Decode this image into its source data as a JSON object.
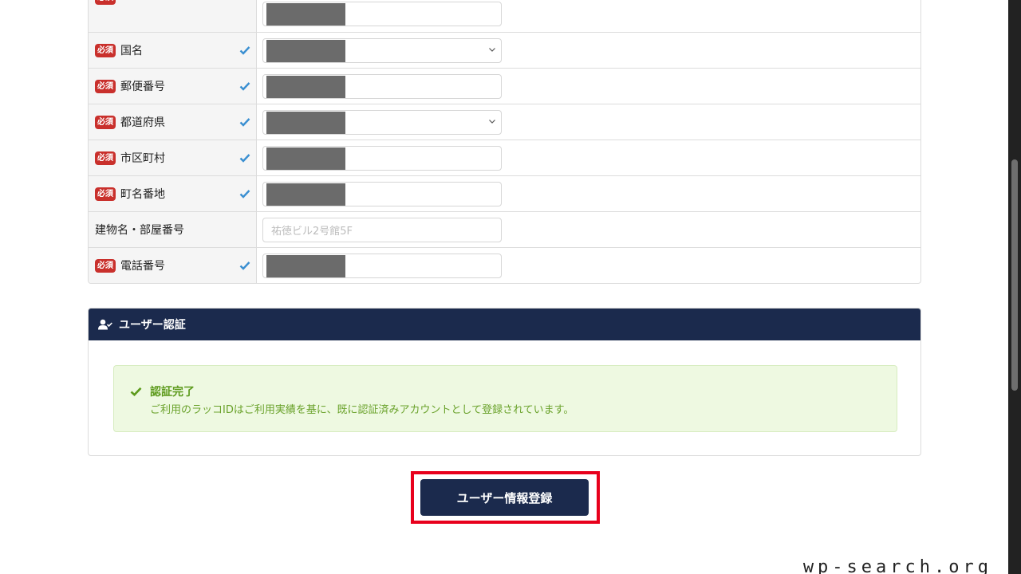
{
  "form": {
    "required_label": "必須",
    "rows": [
      {
        "label": "",
        "required": true,
        "checked": true,
        "type": "text",
        "masked": true
      },
      {
        "label": "国名",
        "required": true,
        "checked": true,
        "type": "select",
        "masked": true
      },
      {
        "label": "郵便番号",
        "required": true,
        "checked": true,
        "type": "text",
        "masked": true
      },
      {
        "label": "都道府県",
        "required": true,
        "checked": true,
        "type": "select",
        "masked": true
      },
      {
        "label": "市区町村",
        "required": true,
        "checked": true,
        "type": "text",
        "masked": true
      },
      {
        "label": "町名番地",
        "required": true,
        "checked": true,
        "type": "text",
        "masked": true
      },
      {
        "label": "建物名・部屋番号",
        "required": false,
        "checked": false,
        "type": "text",
        "masked": false,
        "placeholder": "祐徳ビル2号館5F"
      },
      {
        "label": "電話番号",
        "required": true,
        "checked": true,
        "type": "text",
        "masked": true
      }
    ]
  },
  "auth": {
    "title": "ユーザー認証",
    "alert_title": "認証完了",
    "alert_body": "ご利用のラッコIDはご利用実績を基に、既に認証済みアカウントとして登録されています。"
  },
  "submit_label": "ユーザー情報登録",
  "watermark": "wp-search.org",
  "colors": {
    "navy": "#1b2a4d",
    "required_red": "#c9302c",
    "check_blue": "#3a8fd1",
    "success_green": "#5c9a1b",
    "highlight_red": "#e8001c"
  }
}
